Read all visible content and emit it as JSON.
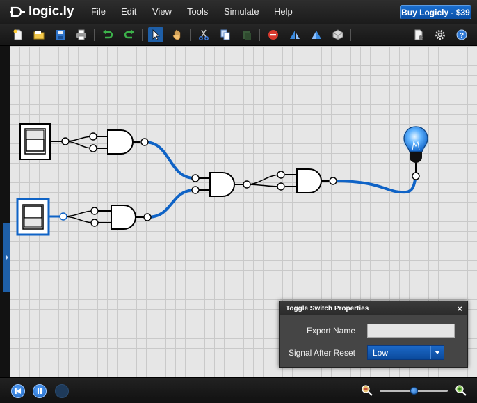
{
  "app": {
    "logo_text": "logic.ly"
  },
  "menu": {
    "items": [
      "File",
      "Edit",
      "View",
      "Tools",
      "Simulate",
      "Help"
    ]
  },
  "buy_button": "Buy Logicly - $39",
  "toolbar": {
    "icons": [
      "new-file-icon",
      "open-folder-icon",
      "save-icon",
      "print-icon",
      "undo-icon",
      "redo-icon",
      "select-arrow-icon",
      "hand-pan-icon",
      "cut-icon",
      "copy-icon",
      "paste-icon",
      "delete-icon",
      "flip-icon",
      "mirror-icon",
      "integrated-circuit-icon",
      "export-icon",
      "settings-gear-icon",
      "help-icon"
    ],
    "active_tool": "select-arrow-icon"
  },
  "properties_panel": {
    "title": "Toggle Switch Properties",
    "close_symbol": "×",
    "export_name_label": "Export Name",
    "export_name_value": "",
    "signal_label": "Signal After Reset",
    "signal_value": "Low"
  },
  "bottom": {
    "zoom_level": 0.5
  },
  "colors": {
    "wire_active": "#0f63c6",
    "wire_inactive": "#000000",
    "accent": "#1e5fa8",
    "bulb_lit": "#2a8af0"
  }
}
